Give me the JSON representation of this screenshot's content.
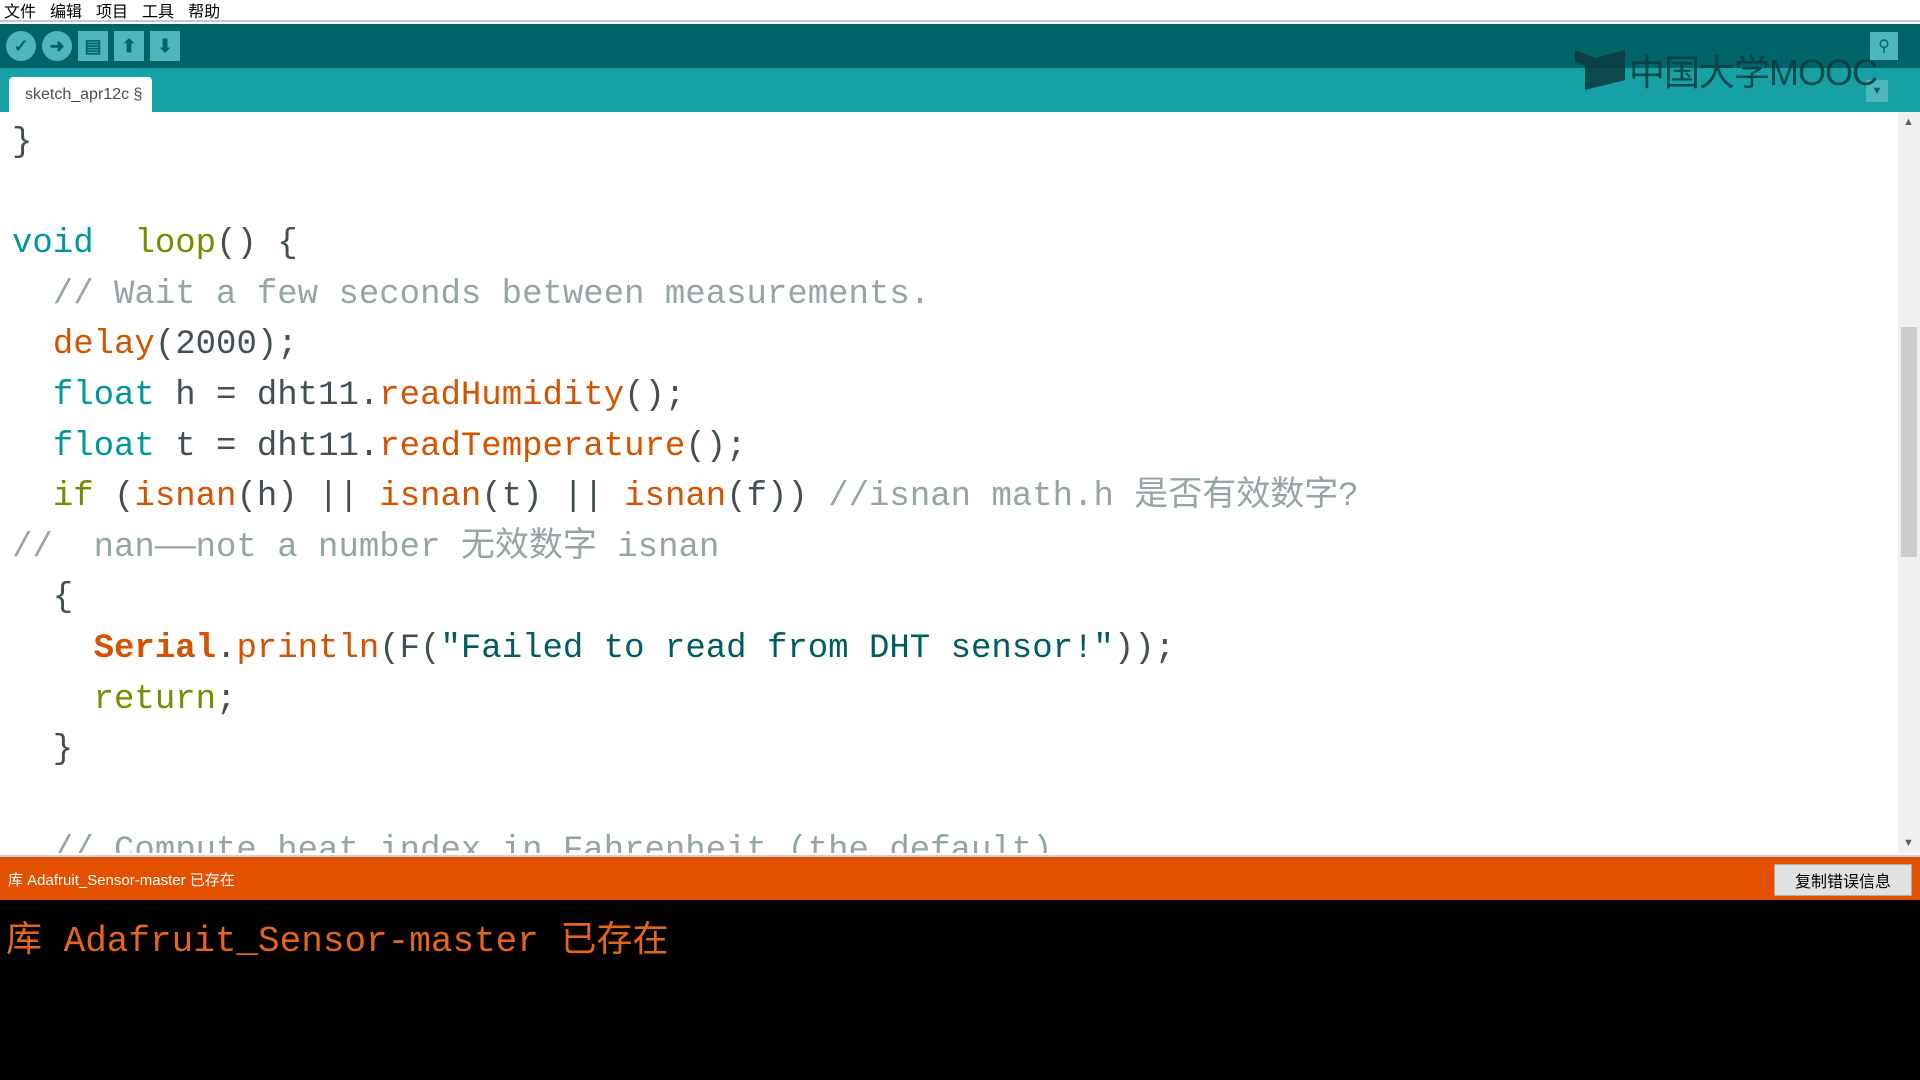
{
  "menu": [
    "文件",
    "编辑",
    "项目",
    "工具",
    "帮助"
  ],
  "toolbar": {
    "buttons": [
      {
        "name": "verify-button",
        "icon": "check-icon",
        "glyph": "✓",
        "round": true
      },
      {
        "name": "upload-button",
        "icon": "arrow-right-icon",
        "glyph": "➜",
        "round": true
      },
      {
        "name": "new-button",
        "icon": "document-icon",
        "glyph": "▤",
        "round": false
      },
      {
        "name": "open-button",
        "icon": "arrow-up-icon",
        "glyph": "⬆",
        "round": false
      },
      {
        "name": "save-button",
        "icon": "arrow-down-icon",
        "glyph": "⬇",
        "round": false
      }
    ],
    "serial_monitor_glyph": "⚲",
    "tab_menu_glyph": "▼"
  },
  "tab": {
    "label": "sketch_apr12c §"
  },
  "logo": {
    "text": "中国大学MOOC"
  },
  "colors": {
    "toolbar": "#006468",
    "tabbar": "#17a1a5",
    "status": "#e35100",
    "keyword": "#00979c",
    "function": "#d35400",
    "comment": "#95a5a6",
    "console_text": "#e5661a"
  },
  "editor": {
    "lines": [
      [
        [
          "",
          "}"
        ]
      ],
      [],
      [
        [
          "kw",
          "void"
        ],
        [
          "",
          "  "
        ],
        [
          "ol",
          "loop"
        ],
        [
          "",
          "() {"
        ]
      ],
      [
        [
          "cm",
          "  // Wait a few seconds between measurements."
        ]
      ],
      [
        [
          "",
          "  "
        ],
        [
          "fn",
          "delay"
        ],
        [
          "",
          "(2000);"
        ]
      ],
      [
        [
          "",
          "  "
        ],
        [
          "kw",
          "float"
        ],
        [
          "",
          " h = dht11."
        ],
        [
          "fn",
          "readHumidity"
        ],
        [
          "",
          "();"
        ]
      ],
      [
        [
          "",
          "  "
        ],
        [
          "kw",
          "float"
        ],
        [
          "",
          " t = dht11."
        ],
        [
          "fn",
          "readTemperature"
        ],
        [
          "",
          "();"
        ]
      ],
      [
        [
          "",
          "  "
        ],
        [
          "ol",
          "if"
        ],
        [
          "",
          " ("
        ],
        [
          "fn",
          "isnan"
        ],
        [
          "",
          "(h) || "
        ],
        [
          "fn",
          "isnan"
        ],
        [
          "",
          "(t) || "
        ],
        [
          "fn",
          "isnan"
        ],
        [
          "",
          "(f)) "
        ],
        [
          "cm",
          "//isnan math.h 是否有效数字?"
        ]
      ],
      [
        [
          "cm",
          "//  nan——not a number 无效数字 isnan"
        ]
      ],
      [
        [
          "",
          "  {"
        ]
      ],
      [
        [
          "",
          "    "
        ],
        [
          "cls",
          "Serial"
        ],
        [
          "",
          "."
        ],
        [
          "fn",
          "println"
        ],
        [
          "",
          "(F("
        ],
        [
          "str",
          "\"Failed to read from DHT sensor!\""
        ],
        [
          "",
          "));"
        ]
      ],
      [
        [
          "",
          "    "
        ],
        [
          "ol",
          "return"
        ],
        [
          "",
          ";"
        ]
      ],
      [
        [
          "",
          "  }"
        ]
      ],
      [],
      [
        [
          "cm",
          "  // Compute heat index in Fahrenheit (the default)"
        ]
      ]
    ]
  },
  "status": {
    "message": "库 Adafruit_Sensor-master 已存在",
    "copy_button": "复制错误信息"
  },
  "console": {
    "text": "库 Adafruit_Sensor-master 已存在"
  }
}
